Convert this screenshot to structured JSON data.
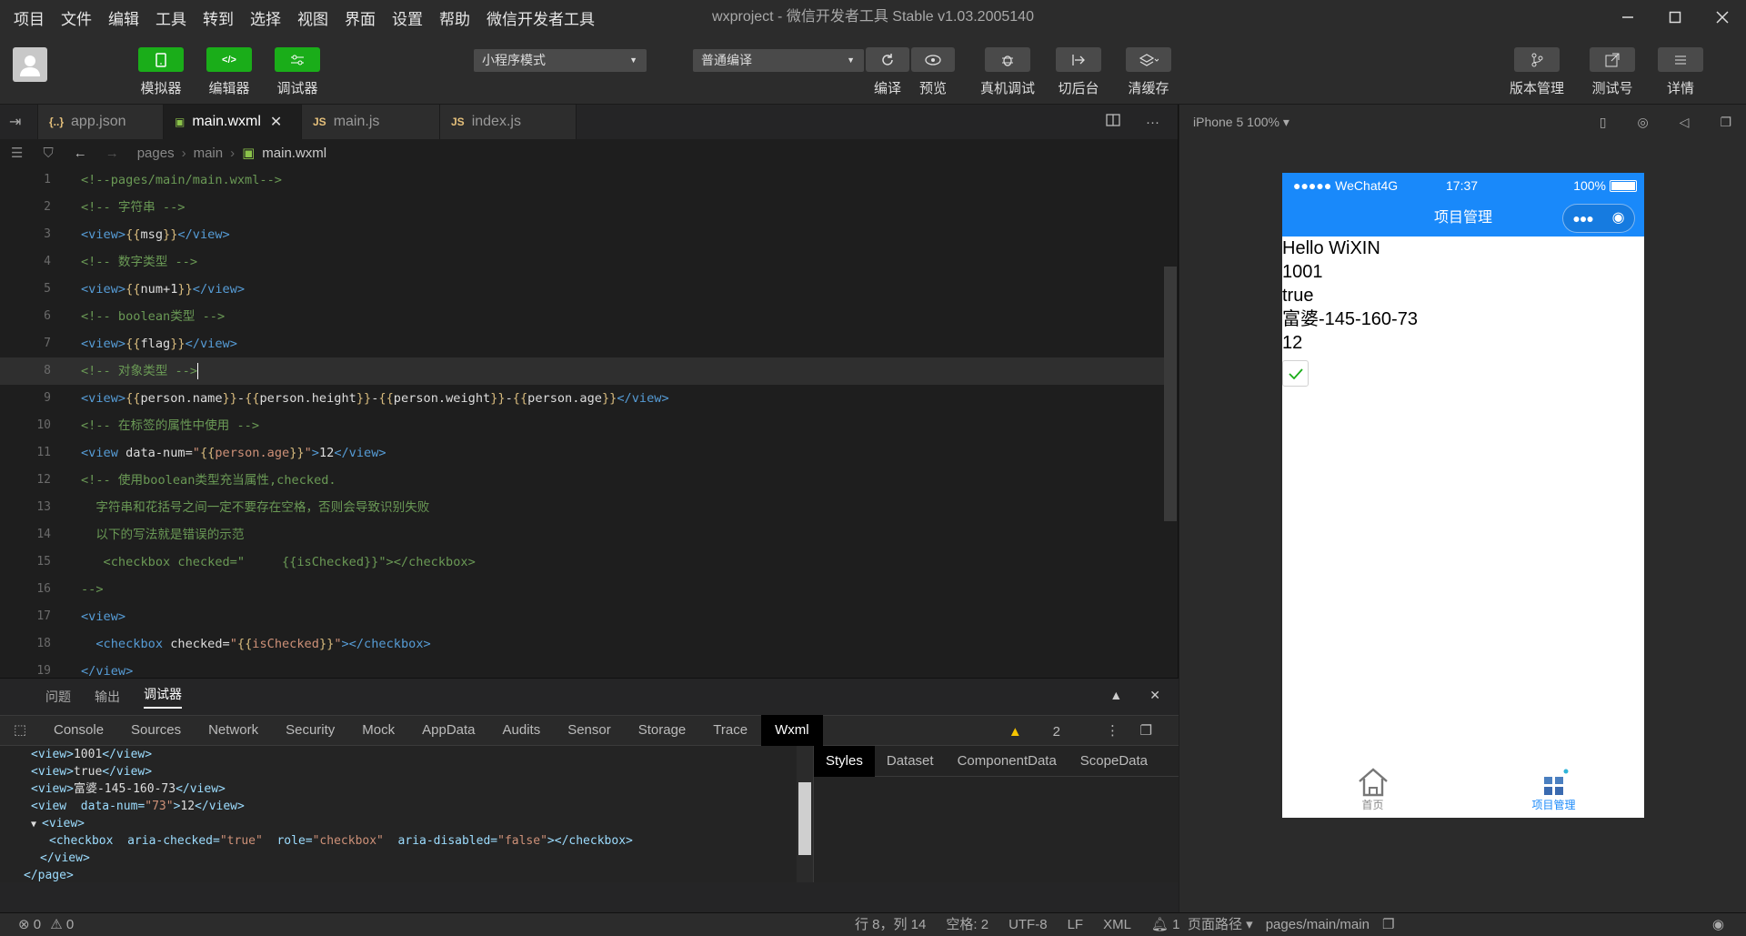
{
  "menubar": {
    "items": [
      "项目",
      "文件",
      "编辑",
      "工具",
      "转到",
      "选择",
      "视图",
      "界面",
      "设置",
      "帮助",
      "微信开发者工具"
    ],
    "title": "wxproject - 微信开发者工具 Stable v1.03.2005140"
  },
  "toolbar": {
    "simulator": "模拟器",
    "editor": "编辑器",
    "debugger": "调试器",
    "mode_select": "小程序模式",
    "compile_select": "普通编译",
    "compile": "编译",
    "preview": "预览",
    "remote_debug": "真机调试",
    "background": "切后台",
    "clear_cache": "清缓存",
    "version": "版本管理",
    "test_id": "测试号",
    "details": "详情"
  },
  "tabs": [
    {
      "label": "app.json",
      "icon": "{..}",
      "icon_color": "#e5c07b"
    },
    {
      "label": "main.wxml",
      "icon": "</>",
      "icon_color": "#8bc34a"
    },
    {
      "label": "main.js",
      "icon": "JS",
      "icon_color": "#e5c07b"
    },
    {
      "label": "index.js",
      "icon": "JS",
      "icon_color": "#e5c07b"
    }
  ],
  "breadcrumb": [
    "pages",
    "main",
    "main.wxml"
  ],
  "code_line_numbers": [
    "1",
    "2",
    "3",
    "4",
    "5",
    "6",
    "7",
    "8",
    "9",
    "10",
    "11",
    "12",
    "13",
    "14",
    "15",
    "16",
    "17",
    "18",
    "19"
  ],
  "debugger": {
    "tabs": [
      "问题",
      "输出",
      "调试器"
    ],
    "devtools_tabs": [
      "Console",
      "Sources",
      "Network",
      "Security",
      "Mock",
      "AppData",
      "Audits",
      "Sensor",
      "Storage",
      "Trace",
      "Wxml"
    ],
    "warnings": "2",
    "style_tabs": [
      "Styles",
      "Dataset",
      "ComponentData",
      "ScopeData"
    ]
  },
  "statusbar": {
    "errors": "0",
    "warnings": "0",
    "position": "行 8，列 14",
    "spaces": "空格: 2",
    "encoding": "UTF-8",
    "eol": "LF",
    "lang": "XML",
    "notifications": "1",
    "page_path_label": "页面路径",
    "page_path": "pages/main/main"
  },
  "simulator": {
    "device": "iPhone 5 100%",
    "carrier": "●●●●● WeChat4G",
    "time": "17:37",
    "battery": "100%",
    "nav_title": "项目管理",
    "content": [
      "Hello WiXIN",
      "1001",
      "true",
      "富婆-145-160-73",
      "12"
    ],
    "checkbox_checked": true,
    "tab_home": "首页",
    "tab_project": "项目管理"
  },
  "colors": {
    "brand_green": "#1aad19",
    "nav_blue": "#1989fa"
  }
}
